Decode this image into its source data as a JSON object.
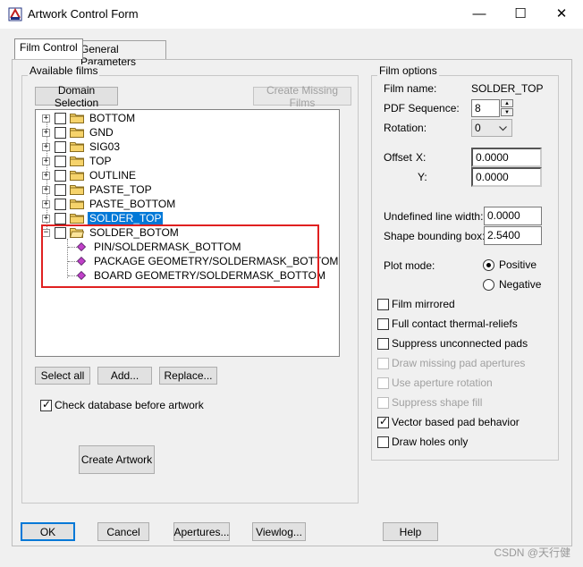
{
  "window": {
    "title": "Artwork Control Form",
    "minimize": "—",
    "maximize": "☐",
    "close": "✕"
  },
  "tabs": [
    {
      "label": "Film Control",
      "active": true
    },
    {
      "label": "General Parameters",
      "active": false
    }
  ],
  "available_films": {
    "group_label": "Available films",
    "domain_selection": "Domain Selection",
    "create_missing": "Create Missing Films",
    "films": [
      {
        "label": "BOTTOM",
        "expanded": false,
        "checked": false,
        "selected": false
      },
      {
        "label": "GND",
        "expanded": false,
        "checked": false,
        "selected": false
      },
      {
        "label": "SIG03",
        "expanded": false,
        "checked": false,
        "selected": false
      },
      {
        "label": "TOP",
        "expanded": false,
        "checked": false,
        "selected": false
      },
      {
        "label": "OUTLINE",
        "expanded": false,
        "checked": false,
        "selected": false
      },
      {
        "label": "PASTE_TOP",
        "expanded": false,
        "checked": false,
        "selected": false
      },
      {
        "label": "PASTE_BOTTOM",
        "expanded": false,
        "checked": false,
        "selected": false
      },
      {
        "label": "SOLDER_TOP",
        "expanded": false,
        "checked": false,
        "selected": true
      },
      {
        "label": "SOLDER_BOTOM",
        "expanded": true,
        "checked": false,
        "selected": false
      }
    ],
    "children": [
      "PIN/SOLDERMASK_BOTTOM",
      "PACKAGE GEOMETRY/SOLDERMASK_BOTTOM",
      "BOARD GEOMETRY/SOLDERMASK_BOTTOM"
    ],
    "select_all": "Select all",
    "add": "Add...",
    "replace": "Replace...",
    "check_db": "Check database before artwork",
    "check_db_checked": true,
    "create_artwork": "Create Artwork"
  },
  "film_options": {
    "group_label": "Film options",
    "film_name_label": "Film name:",
    "film_name_value": "SOLDER_TOP",
    "pdf_seq_label": "PDF Sequence:",
    "pdf_seq_value": "8",
    "rotation_label": "Rotation:",
    "rotation_value": "0",
    "offset_label": "Offset",
    "x_label": "X:",
    "x_value": "0.0000",
    "y_label": "Y:",
    "y_value": "0.0000",
    "undef_line_label": "Undefined line width:",
    "undef_line_value": "0.0000",
    "shape_bound_label": "Shape bounding box:",
    "shape_bound_value": "2.5400",
    "plot_mode_label": "Plot mode:",
    "positive_label": "Positive",
    "negative_label": "Negative",
    "plot_mode_selected": "Positive",
    "checkboxes": [
      {
        "label": "Film mirrored",
        "checked": false,
        "enabled": true
      },
      {
        "label": "Full contact thermal-reliefs",
        "checked": false,
        "enabled": true
      },
      {
        "label": "Suppress unconnected pads",
        "checked": false,
        "enabled": true
      },
      {
        "label": "Draw missing pad apertures",
        "checked": false,
        "enabled": false
      },
      {
        "label": "Use aperture rotation",
        "checked": false,
        "enabled": false
      },
      {
        "label": "Suppress shape fill",
        "checked": false,
        "enabled": false
      },
      {
        "label": "Vector based pad behavior",
        "checked": true,
        "enabled": true
      },
      {
        "label": "Draw holes only",
        "checked": false,
        "enabled": true
      }
    ]
  },
  "bottom_buttons": {
    "ok": "OK",
    "cancel": "Cancel",
    "apertures": "Apertures...",
    "viewlog": "Viewlog...",
    "help": "Help"
  },
  "watermark": "CSDN @天行健"
}
